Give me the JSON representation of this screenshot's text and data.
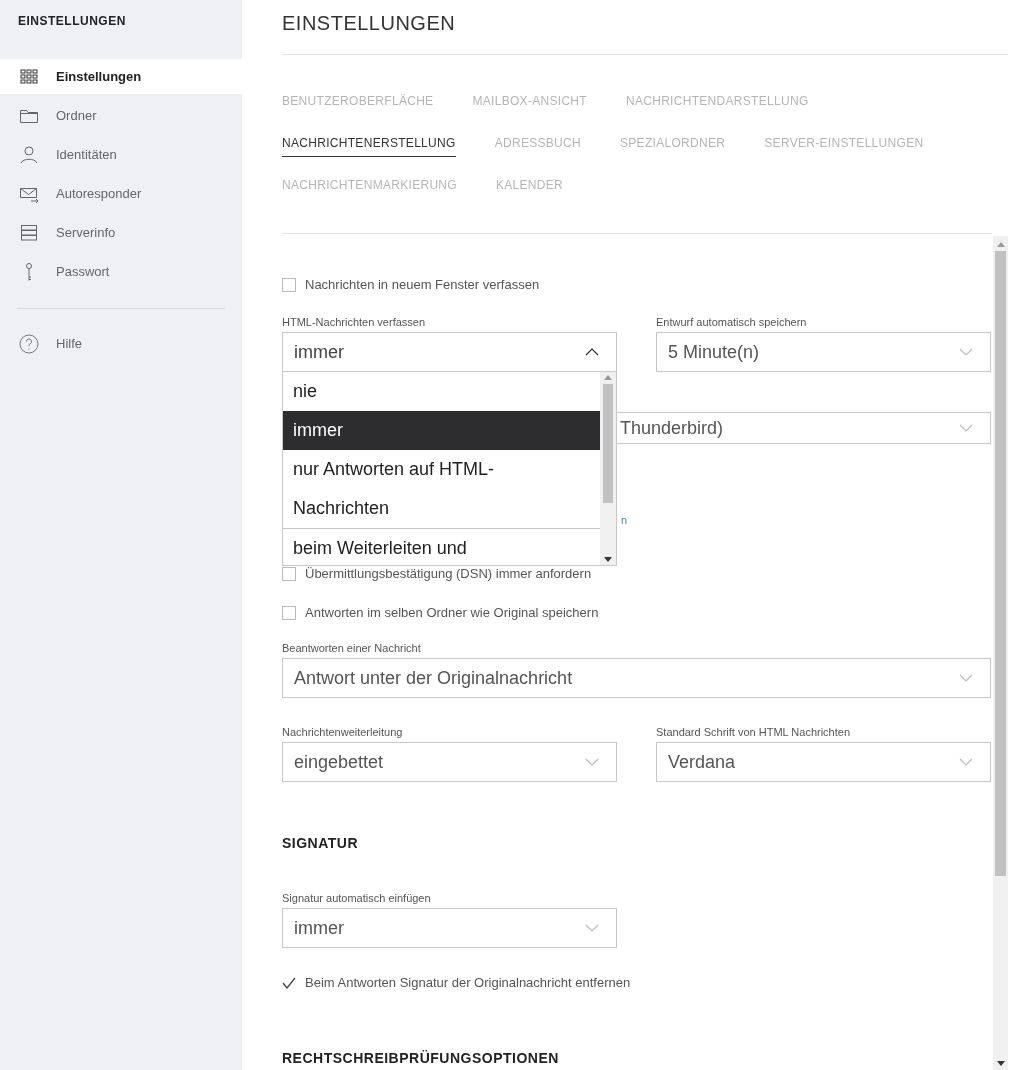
{
  "sidebar": {
    "title": "EINSTELLUNGEN",
    "items": [
      {
        "label": "Einstellungen",
        "selected": true
      },
      {
        "label": "Ordner",
        "selected": false
      },
      {
        "label": "Identitäten",
        "selected": false
      },
      {
        "label": "Autoresponder",
        "selected": false
      },
      {
        "label": "Serverinfo",
        "selected": false
      },
      {
        "label": "Passwort",
        "selected": false
      }
    ],
    "help": {
      "label": "Hilfe"
    }
  },
  "header": {
    "title": "EINSTELLUNGEN"
  },
  "tab_rows": [
    [
      {
        "label": "BENUTZEROBERFLÄCHE",
        "selected": false
      },
      {
        "label": "MAILBOX-ANSICHT",
        "selected": false
      },
      {
        "label": "NACHRICHTENDARSTELLUNG",
        "selected": false
      }
    ],
    [
      {
        "label": "NACHRICHTENERSTELLUNG",
        "selected": true
      },
      {
        "label": "ADRESSBUCH",
        "selected": false
      },
      {
        "label": "SPEZIALORDNER",
        "selected": false
      },
      {
        "label": "SERVER-EINSTELLUNGEN",
        "selected": false
      }
    ],
    [
      {
        "label": "NACHRICHTENMARKIERUNG",
        "selected": false
      },
      {
        "label": "KALENDER",
        "selected": false
      }
    ]
  ],
  "form": [
    {
      "kind": "checkbox",
      "label": "Nachrichten in neuem Fenster verfassen",
      "checked": false
    },
    {
      "kind": "select_pair",
      "selects": [
        {
          "label": "HTML-Nachrichten verfassen",
          "value": "immer",
          "expanded": true
        },
        {
          "label": "Entwurf automatisch speichern",
          "value": "5 Minute(n)",
          "expanded": false
        }
      ]
    },
    {
      "kind": "covered_select",
      "value": "Thunderbird)"
    },
    {
      "kind": "covered_link",
      "text": "n"
    },
    {
      "kind": "checkbox",
      "label": "Übermittlungsbestätigung (DSN) immer anfordern",
      "checked": false
    },
    {
      "kind": "checkbox",
      "label": "Antworten im selben Ordner wie Original speichern",
      "checked": false
    },
    {
      "kind": "select_full",
      "label": "Beantworten einer Nachricht",
      "value": "Antwort unter der Originalnachricht",
      "expanded": false
    },
    {
      "kind": "select_pair",
      "selects": [
        {
          "label": "Nachrichtenweiterleitung",
          "value": "eingebettet",
          "expanded": false
        },
        {
          "label": "Standard Schrift von HTML Nachrichten",
          "value": "Verdana",
          "expanded": false
        }
      ]
    },
    {
      "kind": "heading",
      "text": "SIGNATUR"
    },
    {
      "kind": "select_half",
      "label": "Signatur automatisch einfügen",
      "value": "immer",
      "expanded": false
    },
    {
      "kind": "checkbox",
      "label": "Beim Antworten Signatur der Originalnachricht entfernen",
      "checked": true
    },
    {
      "kind": "heading",
      "text": "RECHTSCHREIBPRÜFUNGSOPTIONEN"
    }
  ],
  "dropdown": {
    "options": [
      {
        "label": "nie",
        "selected": false
      },
      {
        "label": "immer",
        "selected": true
      },
      {
        "label": "nur Antworten auf HTML-Nachrichten",
        "selected": false
      },
      {
        "label": "beim Weiterleiten und",
        "selected": false
      }
    ]
  }
}
